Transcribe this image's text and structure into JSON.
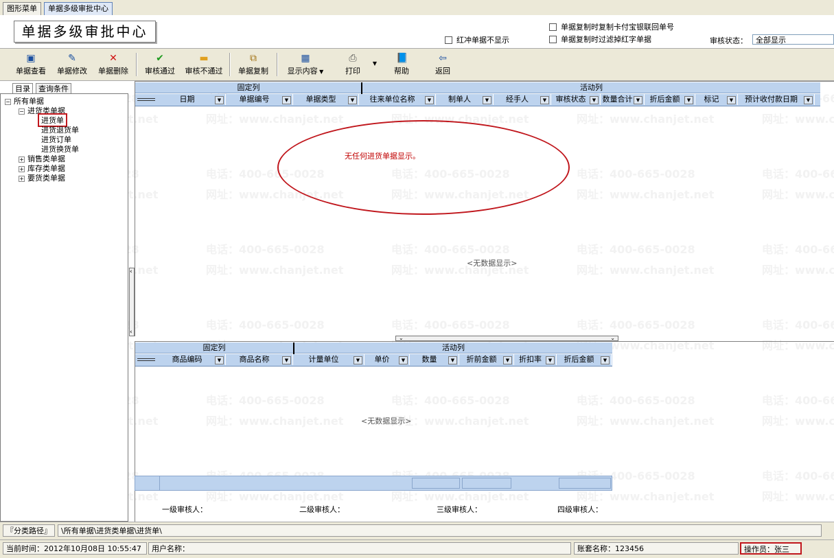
{
  "tabs": [
    "图形菜单",
    "单据多级审批中心"
  ],
  "logo_text": "单据多级审批中心",
  "options": {
    "hide_red_reverse": "红冲单据不显示",
    "copy_bank_receipt": "单据复制时复制卡付宝银联回单号",
    "copy_filter_red": "单据复制时过滤掉红字单据",
    "audit_status_label": "审核状态：",
    "audit_status_value": "全部显示"
  },
  "toolbar": {
    "view": "单据查看",
    "edit": "单据修改",
    "delete": "单据删除",
    "approve": "审核通过",
    "reject": "审核不通过",
    "copy": "单据复制",
    "display": "显示内容",
    "print": "打印",
    "help": "帮助",
    "back": "返回"
  },
  "left_tabs": [
    "目录",
    "查询条件"
  ],
  "tree": {
    "root": "所有单据",
    "purchase": "进货类单据",
    "purchase_children": [
      "进货单",
      "进货退货单",
      "进货订单",
      "进货换货单"
    ],
    "sales": "销售类单据",
    "inventory": "库存类单据",
    "request": "要货类单据"
  },
  "upper_grid": {
    "group_fixed": "固定列",
    "group_active": "活动列",
    "columns": [
      "日期",
      "单据编号",
      "单据类型",
      "往来单位名称",
      "制单人",
      "经手人",
      "审核状态",
      "数量合计",
      "折后金额",
      "标记",
      "预计收付款日期"
    ],
    "message": "无任何进货单据显示。",
    "nodata": "<无数据显示>"
  },
  "lower_grid": {
    "group_fixed": "固定列",
    "group_active": "活动列",
    "columns": [
      "商品编码",
      "商品名称",
      "计量单位",
      "单价",
      "数量",
      "折前金额",
      "折扣率",
      "折后金额"
    ],
    "nodata": "<无数据显示>"
  },
  "approvers": [
    "一级审核人：",
    "二级审核人：",
    "三级审核人：",
    "四级审核人："
  ],
  "path": {
    "label": "『分类路径』",
    "value": "\\所有单据\\进货类单据\\进货单\\"
  },
  "status": {
    "time": "当前时间：2012年10月08日 10:55:47",
    "user": "用户名称：",
    "account": "账套名称：123456",
    "operator": "操作员：张三"
  },
  "watermark": {
    "phone": "电话：400-665-0028",
    "site": "网址：www.chanjet.net"
  },
  "colors": {
    "highlight_red": "#c0161c",
    "grid_header": "#bdd3ee"
  }
}
